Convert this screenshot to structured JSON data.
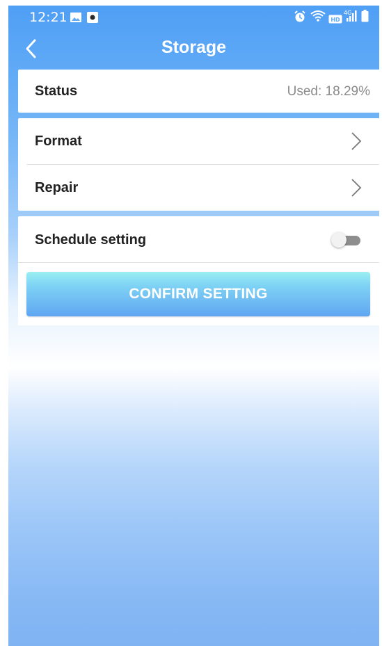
{
  "status_bar": {
    "time": "12:21",
    "icons": [
      "image-icon",
      "screen-record-icon",
      "alarm-icon",
      "wifi-icon",
      "hd-badge-icon",
      "4g-signal-icon",
      "battery-icon"
    ],
    "network_label": "4G"
  },
  "header": {
    "title": "Storage",
    "back_icon": "chevron-left-icon"
  },
  "status_card": {
    "label": "Status",
    "value": "Used: 18.29%"
  },
  "actions_card": {
    "items": [
      {
        "label": "Format",
        "icon": "chevron-right-icon"
      },
      {
        "label": "Repair",
        "icon": "chevron-right-icon"
      }
    ]
  },
  "schedule_card": {
    "label": "Schedule setting",
    "toggle_on": false,
    "confirm_label": "CONFIRM SETTING"
  },
  "colors": {
    "accent": "#4f9ff5",
    "button_top": "#9af0f2",
    "button_bottom": "#5fa5f2",
    "text_primary": "#222222",
    "text_secondary": "#8a8a8a"
  }
}
